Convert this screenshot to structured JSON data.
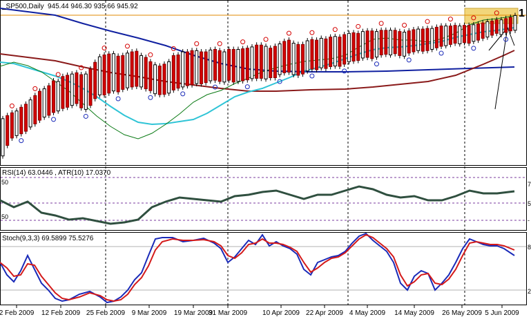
{
  "chart_data": [
    {
      "type": "candlestick",
      "title": "_SP500,Daily",
      "ohlc_readout": "945.44 946.30 935.66 945.92",
      "x_ticks": [
        "2 Feb 2009",
        "12 Feb 2009",
        "25 Feb 2009",
        "9 Mar 2009",
        "19 Mar 2009",
        "31 Mar 2009",
        "10 Apr 2009",
        "22 Apr 2009",
        "4 May 2009",
        "14 May 2009",
        "26 May 2009",
        "5 Jun 2009"
      ],
      "axis_right_partial_label": "1",
      "colors": {
        "up_candle": "#ffffff",
        "down_candle": "#d40000",
        "ma_fast": "#0a7a14",
        "ma_mid": "#2fc4d6",
        "ma_slow_red": "#8a1a1a",
        "ma_slow_blue": "#1020a0",
        "price_line": "#e08a00",
        "highlight": "#f2d67a"
      },
      "series": [
        {
          "values": [
            54,
            88,
            112,
            120,
            126,
            134,
            148,
            158,
            170,
            180,
            186,
            195,
            200,
            208,
            212,
            218,
            224,
            210,
            205,
            218,
            240,
            252,
            252,
            258,
            265,
            262,
            270,
            275,
            278,
            280,
            278,
            272,
            266,
            256,
            253,
            254,
            258,
            268,
            274,
            278,
            282,
            285,
            289,
            288,
            292,
            298,
            300,
            296,
            294,
            300,
            294,
            296,
            298,
            301,
            305,
            306,
            306,
            304,
            308,
            308,
            318,
            324,
            326,
            318,
            316,
            320,
            330,
            336,
            334,
            340,
            338,
            344,
            346,
            345,
            352,
            360,
            362,
            364,
            372,
            374,
            370,
            375,
            382,
            384,
            382,
            386,
            380,
            378,
            388,
            392,
            396,
            394,
            396,
            400,
            405,
            410,
            412,
            416,
            420,
            418,
            422,
            420,
            426,
            430,
            436,
            440,
            446,
            452,
            448,
            455,
            460,
            462
          ]
        },
        {
          "values": [
            175,
            185,
            194,
            200,
            212,
            222,
            236,
            250,
            264,
            272,
            282,
            298,
            296,
            312,
            316,
            320,
            324,
            318,
            320,
            336,
            358,
            376,
            382,
            385,
            386,
            378,
            380,
            388,
            392,
            394,
            380,
            374,
            360,
            350,
            346,
            352,
            360,
            380,
            382,
            392,
            392,
            396,
            396,
            392,
            392,
            398,
            400,
            396,
            392,
            400,
            400,
            400,
            402,
            404,
            408,
            414,
            414,
            410,
            404,
            410,
            418,
            426,
            430,
            420,
            416,
            416,
            428,
            432,
            430,
            436,
            434,
            440,
            442,
            440,
            448,
            452,
            454,
            452,
            458,
            460,
            460,
            458,
            462,
            462,
            462,
            462,
            458,
            456,
            460,
            464,
            466,
            466,
            468,
            468,
            472,
            476,
            476,
            476,
            478,
            476,
            478,
            478,
            480,
            482,
            486,
            490,
            492,
            496,
            496,
            500,
            504,
            510
          ]
        }
      ]
    },
    {
      "type": "line",
      "title": "RSI(14) 63.0446 , ATR(10) 17.0370",
      "left_tick_labels": [
        "50",
        "50"
      ],
      "right_partial_labels": [
        "7",
        "5",
        "-"
      ]
    },
    {
      "type": "line",
      "title": "Stoch(9,3,3) 69.5899 75.5276",
      "right_partial_labels": [
        "8",
        "2"
      ]
    }
  ]
}
